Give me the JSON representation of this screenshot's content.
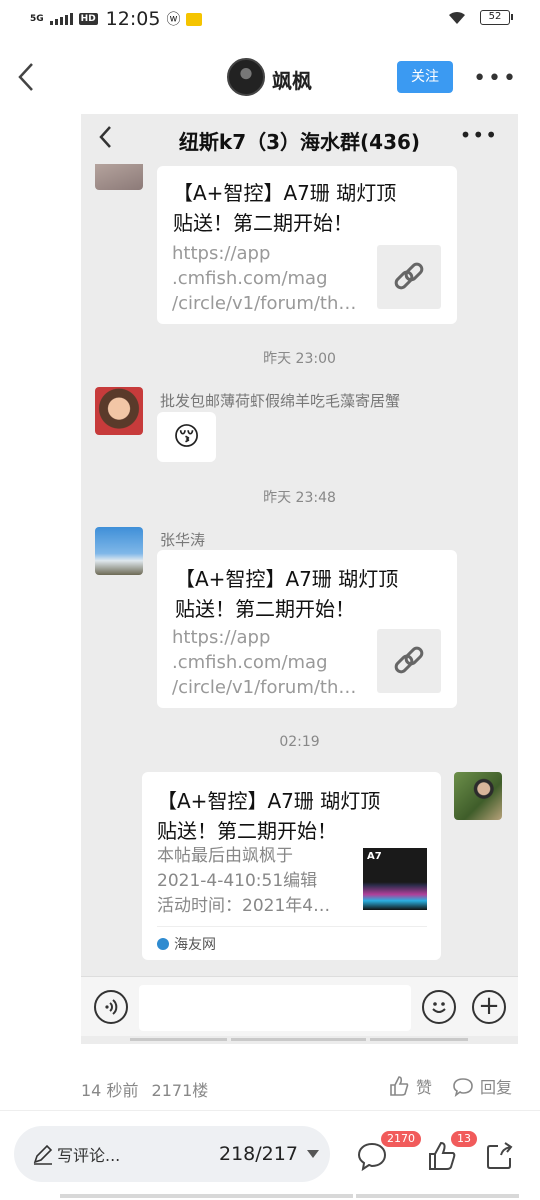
{
  "status_bar": {
    "network": "5G",
    "hd": "HD",
    "time": "12:05",
    "weibo": "ⓦ",
    "battery": "52"
  },
  "header": {
    "author_name": "飒枫",
    "follow_label": "关注",
    "more": "•••"
  },
  "chat": {
    "title": "纽斯k7（3）海水群(436)",
    "more": "•••",
    "messages": [
      {
        "type": "link",
        "title_lines": [
          "【A+智控】A7珊 瑚灯顶",
          "贴送！第二期开始！"
        ],
        "url_lines": [
          "https://app",
          ".cmfish.com/mag",
          "/circle/v1/forum/th…"
        ]
      },
      {
        "type": "time",
        "text": "昨天 23:00"
      },
      {
        "type": "emoji",
        "sender": "批发包邮薄荷虾假绵羊吃毛藻寄居蟹",
        "emoji": "😚"
      },
      {
        "type": "time",
        "text": "昨天 23:48"
      },
      {
        "type": "link",
        "sender": "张华涛",
        "title_lines": [
          "【A+智控】A7珊 瑚灯顶",
          "贴送！第二期开始！"
        ],
        "url_lines": [
          "https://app",
          ".cmfish.com/mag",
          "/circle/v1/forum/th…"
        ]
      },
      {
        "type": "time",
        "text": "02:19"
      },
      {
        "type": "card",
        "title_lines": [
          "【A+智控】A7珊 瑚灯顶",
          "贴送！第二期开始！"
        ],
        "desc_lines": [
          "本帖最后由飒枫于",
          "2021-4-410:51编辑",
          "活动时间：2021年4…"
        ],
        "thumb_label": "A7",
        "source": "海友网"
      }
    ]
  },
  "post_meta": {
    "time": "14 秒前",
    "floor": "2171楼",
    "like_label": "赞",
    "reply_label": "回复"
  },
  "bottom_bar": {
    "comment_placeholder": "写评论...",
    "page": "218/217",
    "comment_count": "2170",
    "like_count": "13"
  },
  "colors": {
    "accent": "#3b9af2",
    "badge": "#f15b5b",
    "panel_bg": "#ececec"
  }
}
